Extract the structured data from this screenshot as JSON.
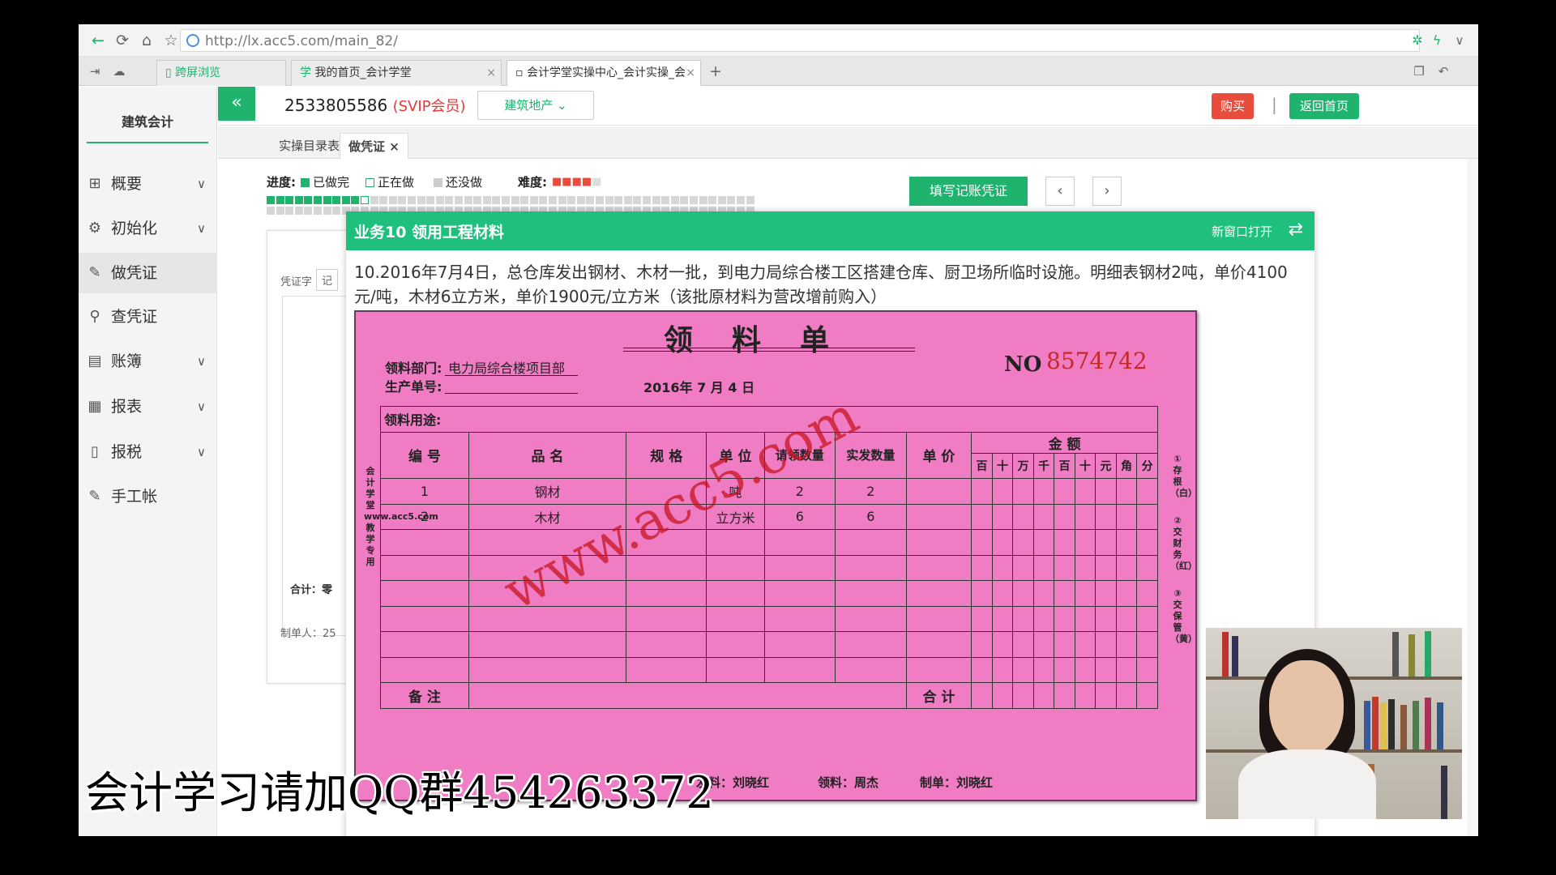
{
  "browser": {
    "url": "http://lx.acc5.com/main_82/",
    "tabs": [
      {
        "label": "跨屏浏览"
      },
      {
        "label": "我的首页_会计学堂"
      },
      {
        "label": "会计学堂实操中心_会计实操_会"
      }
    ],
    "new_tab": "+"
  },
  "sidebar": {
    "title": "建筑会计",
    "items": [
      {
        "label": "概要",
        "icon": "overview-icon",
        "has_sub": true
      },
      {
        "label": "初始化",
        "icon": "gear-icon",
        "has_sub": true
      },
      {
        "label": "做凭证",
        "icon": "pen-icon",
        "has_sub": false
      },
      {
        "label": "查凭证",
        "icon": "search-icon",
        "has_sub": false
      },
      {
        "label": "账簿",
        "icon": "ledger-icon",
        "has_sub": true
      },
      {
        "label": "报表",
        "icon": "report-icon",
        "has_sub": true
      },
      {
        "label": "报税",
        "icon": "tax-file-icon",
        "has_sub": true
      },
      {
        "label": "手工帐",
        "icon": "pen-icon",
        "has_sub": false
      }
    ]
  },
  "topbar": {
    "account_id": "2533805586",
    "vip": "(SVIP会员)",
    "industry": "建筑地产",
    "buy": "购买",
    "separator": "|",
    "home": "返回首页"
  },
  "subtabs": [
    {
      "label": "实操目录表"
    },
    {
      "label": "做凭证",
      "close": "×"
    }
  ],
  "progress": {
    "label": "进度:",
    "done": "已做完",
    "doing": "正在做",
    "todo": "还没做",
    "difficulty_label": "难度:",
    "difficulty_stars": 4,
    "difficulty_max": 5,
    "done_count": 10,
    "current": 11,
    "total": 104
  },
  "actions": {
    "fill_voucher": "填写记账凭证",
    "prev": "‹",
    "next": "›"
  },
  "bg_card": {
    "voucher_word": "凭证字",
    "voucher_value": "记",
    "total_label": "合计：零",
    "maker": "制单人：25"
  },
  "modal": {
    "title": "业务10 领用工程材料",
    "open_new": "新窗口打开",
    "task": "10.2016年7月4日，总仓库发出钢材、木材一批，到电力局综合楼工区搭建仓库、厨卫场所临时设施。明细表钢材2吨，单价4100元/吨，木材6立方米，单价1900元/立方米（该批原材料为营改增前购入）"
  },
  "form": {
    "title": "领料单",
    "no_label": "NO",
    "no_value": "8574742",
    "dept_label": "领料部门:",
    "dept_value": "电力局综合楼项目部",
    "order_label": "生产单号:",
    "date": "2016年 7 月 4 日",
    "use_label": "领料用途:",
    "headers": [
      "编 号",
      "品 名",
      "规 格",
      "单 位",
      "请领数量",
      "实发数量",
      "单 价"
    ],
    "amount_header": "金 额",
    "digits": [
      "百",
      "十",
      "万",
      "千",
      "百",
      "十",
      "元",
      "角",
      "分"
    ],
    "rows": [
      {
        "no": "1",
        "name": "钢材",
        "spec": "",
        "unit": "吨",
        "req": "2",
        "issued": "2",
        "price": ""
      },
      {
        "no": "2",
        "name": "木材",
        "spec": "",
        "unit": "立方米",
        "req": "6",
        "issued": "6",
        "price": ""
      }
    ],
    "empty_rows": 6,
    "remark_label": "备 注",
    "total_label": "合 计",
    "issuer": "发料：刘晓红",
    "receiver": "领料：周杰",
    "maker": "制单：刘晓红",
    "watermark": "www.acc5.com",
    "side_vertical": "会计学堂www.acc5.com教学专用",
    "copies": [
      "①存根（白）",
      "②交财务（红）",
      "③交保管（黄）"
    ]
  },
  "overlay": {
    "qq_banner": "会计学习请加QQ群454263372"
  }
}
